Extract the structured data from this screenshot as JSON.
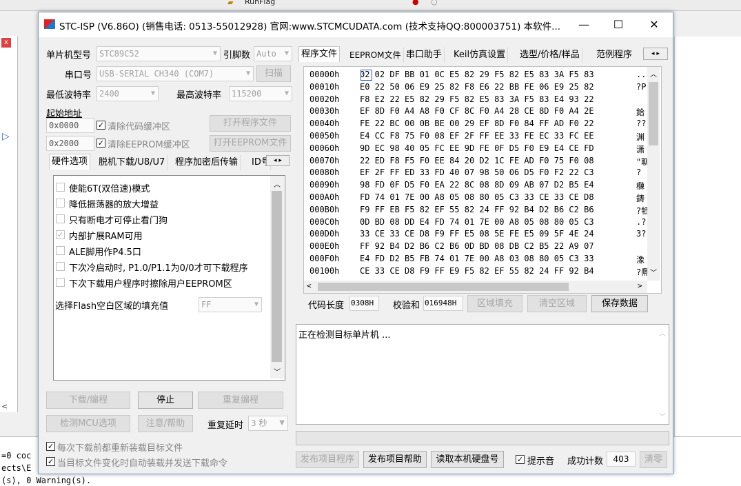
{
  "ide": {
    "toolbar_text": "RunFlag",
    "output_lines": [
      "=0 coc",
      "ects\\E",
      "(s), 0 Warning(s)."
    ]
  },
  "window": {
    "title": "STC-ISP (V6.86O) (销售电话: 0513-55012928) 官网:www.STCMCUDATA.com  (技术支持QQ:800003751) 本软件...",
    "minimize": "—",
    "maximize": "☐",
    "close": "✕"
  },
  "left": {
    "mcu_label": "单片机型号",
    "mcu_value": "STC89C52",
    "pin_label": "引脚数",
    "pin_value": "Auto",
    "port_label": "串口号",
    "port_value": "USB-SERIAL CH340 (COM7)",
    "scan_label": "扫描",
    "min_baud_label": "最低波特率",
    "min_baud_value": "2400",
    "max_baud_label": "最高波特率",
    "max_baud_value": "115200",
    "start_addr_label": "起始地址",
    "addr1": "0x0000",
    "clear_code_label": "清除代码缓冲区",
    "open_program_label": "打开程序文件",
    "addr2": "0x2000",
    "clear_eeprom_label": "清除EEPROM缓冲区",
    "open_eeprom_label": "打开EEPROM文件",
    "tabs": [
      "硬件选项",
      "脱机下载/U8/U7",
      "程序加密后传输",
      "ID号"
    ],
    "options": [
      {
        "label": "使能6T(双倍速)模式",
        "checked": false
      },
      {
        "label": "降低振荡器的放大增益",
        "checked": false
      },
      {
        "label": "只有断电才可停止看门狗",
        "checked": false
      },
      {
        "label": "内部扩展RAM可用",
        "checked": true
      },
      {
        "label": "ALE脚用作P4.5口",
        "checked": false
      },
      {
        "label": "下次冷启动时, P1.0/P1.1为0/0才可下载程序",
        "checked": false
      },
      {
        "label": "下次下载用户程序时擦除用户EEPROM区",
        "checked": false
      }
    ],
    "fill_label": "选择Flash空白区域的填充值",
    "fill_value": "FF",
    "download_label": "下载/编程",
    "stop_label": "停止",
    "reprogram_label": "重复编程",
    "detect_label": "检测MCU选项",
    "help_label": "注意/帮助",
    "repeat_delay_label": "重复延时",
    "repeat_delay_value": "3 秒",
    "reload_label": "每次下载前都重新装载目标文件",
    "autoload_label": "当目标文件变化时自动装载并发送下载命令"
  },
  "right": {
    "tabs": [
      "程序文件",
      "EEPROM文件",
      "串口助手",
      "Keil仿真设置",
      "选型/价格/样品",
      "范例程序"
    ],
    "hex_rows": [
      {
        "addr": "00000h",
        "bytes": "02 02 DF BB 01 0C E5 82 29 F5 82 E5 83 3A F5 83",
        "ascii": "..."
      },
      {
        "addr": "00010h",
        "bytes": "E0 22 50 06 E9 25 82 F8 E6 22 BB FE 06 E9 25 82",
        "ascii": "?P"
      },
      {
        "addr": "00020h",
        "bytes": "F8 E2 22 E5 82 29 F5 82 E5 83 3A F5 83 E4 93 22",
        "ascii": ""
      },
      {
        "addr": "00030h",
        "bytes": "EF 8D F0 A4 A8 F0 CF 8C F0 A4 28 CE 8D F0 A4 2E",
        "ascii": "鉿"
      },
      {
        "addr": "00040h",
        "bytes": "FE 22 BC 00 0B BE 00 29 EF 8D F0 84 FF AD F0 22",
        "ascii": "??"
      },
      {
        "addr": "00050h",
        "bytes": "E4 CC F8 75 F0 08 EF 2F FF EE 33 FE EC 33 FC EE",
        "ascii": "渊"
      },
      {
        "addr": "00060h",
        "bytes": "9D EC 98 40 05 FC EE 9D FE 0F D5 F0 E9 E4 CE FD",
        "ascii": "潇"
      },
      {
        "addr": "00070h",
        "bytes": "22 ED F8 F5 F0 EE 84 20 D2 1C FE AD F0 75 F0 08",
        "ascii": "\"聊"
      },
      {
        "addr": "00080h",
        "bytes": "EF 2F FF ED 33 FD 40 07 98 50 06 D5 F0 F2 22 C3",
        "ascii": "?"
      },
      {
        "addr": "00090h",
        "bytes": "98 FD 0F D5 F0 EA 22 8C 08 8D 09 AB 07 D2 B5 E4",
        "ascii": "樄"
      },
      {
        "addr": "000A0h",
        "bytes": "FD 74 01 7E 00 A8 05 08 80 05 C3 33 CE 33 CE D8",
        "ascii": "鋳"
      },
      {
        "addr": "000B0h",
        "bytes": "F9 FF EB F5 82 EF 55 82 24 FF 92 B4 D2 B6 C2 B6",
        "ascii": "?牴"
      },
      {
        "addr": "000C0h",
        "bytes": "0D BD 08 DD E4 FD 74 01 7E 00 A8 05 08 80 05 C3",
        "ascii": ".?"
      },
      {
        "addr": "000D0h",
        "bytes": "33 CE 33 CE D8 F9 FF E5 08 5E FE E5 09 5F 4E 24",
        "ascii": "3?"
      },
      {
        "addr": "000E0h",
        "bytes": "FF 92 B4 D2 B6 C2 B6 0D BD 08 DB C2 B5 22 A9 07",
        "ascii": ""
      },
      {
        "addr": "000F0h",
        "bytes": "E4 FD D2 B5 FB 74 01 7E 00 A8 03 08 80 05 C3 33",
        "ascii": "潒"
      },
      {
        "addr": "00100h",
        "bytes": "CE 33 CE D8 F9 FF E9 F5 82 EF 55 82 24 FF 92 B4",
        "ascii": "?熈"
      }
    ],
    "code_length_label": "代码长度",
    "code_length_value": "0308H",
    "checksum_label": "校验和",
    "checksum_value": "016948H",
    "fill_region_label": "区域填充",
    "clear_region_label": "清空区域",
    "save_data_label": "保存数据",
    "status_text": "正在检测目标单片机 ...",
    "publish_label": "发布项目程序",
    "publish_help_label": "发布项目帮助",
    "read_disk_label": "读取本机硬盘号",
    "sound_label": "提示音",
    "success_count_label": "成功计数",
    "success_count_value": "403",
    "clear_count_label": "清零"
  }
}
